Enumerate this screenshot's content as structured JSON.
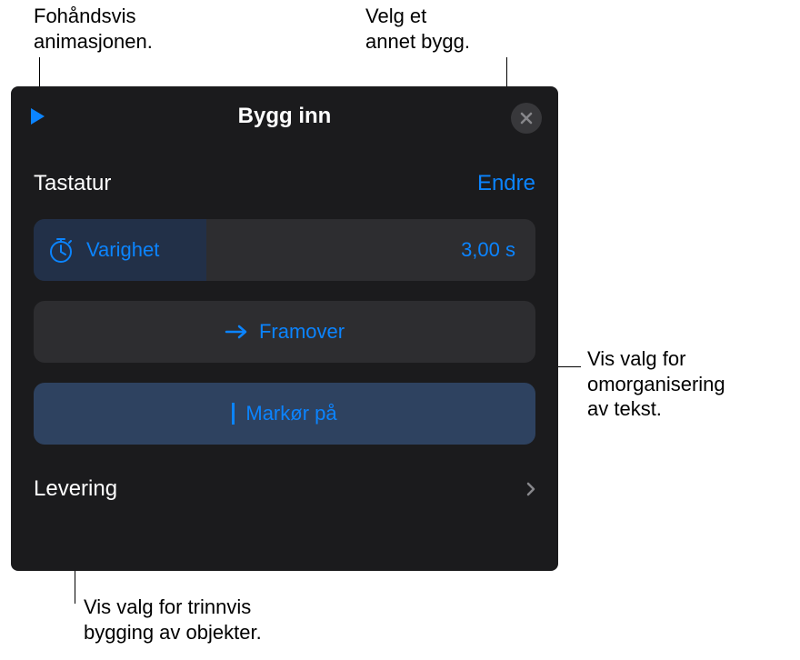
{
  "callouts": {
    "preview": "Fohåndsvis\nanimasjonen.",
    "change": "Velg et\nannet bygg.",
    "direction": "Vis valg for\nomorganisering\nav tekst.",
    "delivery": "Vis valg for trinnvis\nbygging av objekter."
  },
  "panel": {
    "title": "Bygg inn",
    "section_label": "Tastatur",
    "change_label": "Endre",
    "duration": {
      "label": "Varighet",
      "value": "3,00 s"
    },
    "direction_label": "Framover",
    "cursor_label": "Markør på",
    "delivery_label": "Levering"
  }
}
